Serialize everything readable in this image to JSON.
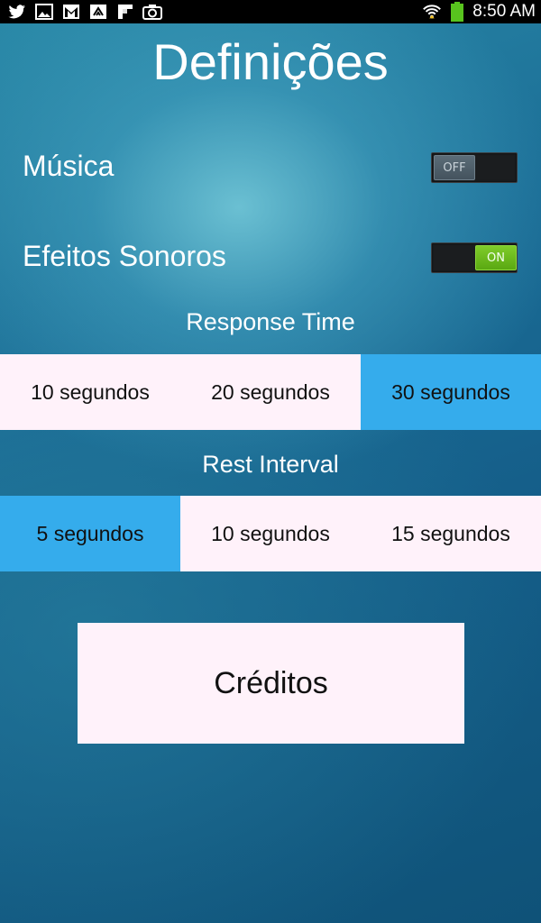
{
  "status_bar": {
    "left_icons": [
      "twitter-icon",
      "gallery-icon",
      "gmail-icon",
      "feedly-icon",
      "flipboard-icon",
      "camera-icon"
    ],
    "right_icons": [
      "wifi-icon",
      "battery-icon"
    ],
    "time": "8:50 AM"
  },
  "page": {
    "title": "Definições"
  },
  "settings": {
    "music": {
      "label": "Música",
      "state": "OFF",
      "on": false
    },
    "sound_effects": {
      "label": "Efeitos Sonoros",
      "state": "ON",
      "on": true
    }
  },
  "response_time": {
    "title": "Response Time",
    "options": [
      "10 segundos",
      "20 segundos",
      "30 segundos"
    ],
    "selected_index": 2
  },
  "rest_interval": {
    "title": "Rest Interval",
    "options": [
      "5 segundos",
      "10 segundos",
      "15 segundos"
    ],
    "selected_index": 0
  },
  "credits_button": {
    "label": "Créditos"
  },
  "colors": {
    "selected": "#35acec",
    "unselected": "#fff2fa",
    "toggle_on": "#6bbb1c",
    "toggle_off": "#4f5f6a"
  }
}
